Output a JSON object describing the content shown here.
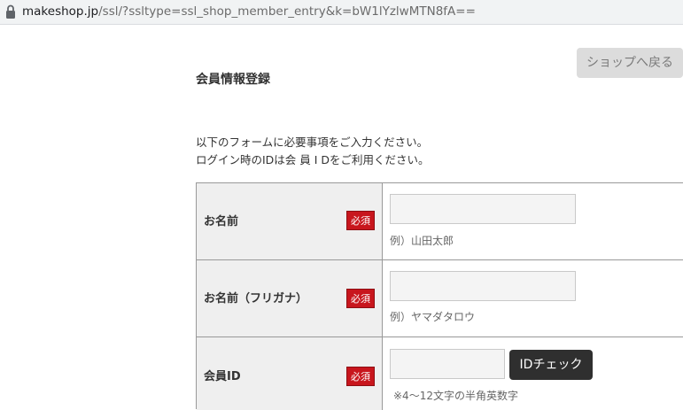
{
  "browser": {
    "url_domain": "makeshop.jp",
    "url_path": "/ssl/?ssltype=ssl_shop_member_entry&k=bW1lYzlwMTN8fA=="
  },
  "header": {
    "back_button_label": "ショップへ戻る",
    "title": "会員情報登録"
  },
  "intro": {
    "line1": "以下のフォームに必要事項をご入力ください。",
    "line2": "ログイン時のIDは会 員 I Dをご利用ください。"
  },
  "form": {
    "required_label": "必須",
    "rows": [
      {
        "label": "お名前",
        "value": "",
        "hint": "例）山田太郎"
      },
      {
        "label": "お名前（フリガナ）",
        "value": "",
        "hint": "例）ヤマダタロウ"
      },
      {
        "label": "会員ID",
        "value": "",
        "hint": "※4～12文字の半角英数字",
        "button_label": "IDチェック"
      }
    ]
  },
  "colors": {
    "required_badge": "#c8161d",
    "id_check_button": "#2f2f2f",
    "label_cell_bg": "#efefef"
  }
}
